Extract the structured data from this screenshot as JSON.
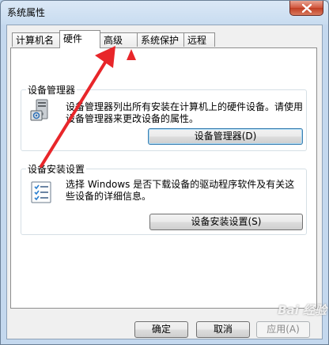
{
  "window": {
    "title": "系统属性"
  },
  "tabs": [
    {
      "label": "计算机名",
      "active": false
    },
    {
      "label": "硬件",
      "active": true
    },
    {
      "label": "高级",
      "active": false
    },
    {
      "label": "系统保护",
      "active": false
    },
    {
      "label": "远程",
      "active": false
    }
  ],
  "device_manager": {
    "group_label": "设备管理器",
    "description": "设备管理器列出所有安装在计算机上的硬件设备。请使用设备管理器来更改设备的属性。",
    "button_label": "设备管理器(D)"
  },
  "device_install": {
    "group_label": "设备安装设置",
    "description": "选择 Windows 是否下载设备的驱动程序软件及有关这些设备的详细信息。",
    "button_label": "设备安装设置(S)"
  },
  "footer": {
    "ok_label": "确定",
    "cancel_label": "取消",
    "apply_label": "应用(A)"
  },
  "watermark": "Bai 经验",
  "colors": {
    "annotation_arrow": "#e8262a",
    "title_bar": "#c4d8ee",
    "close_button": "#c7472d"
  }
}
